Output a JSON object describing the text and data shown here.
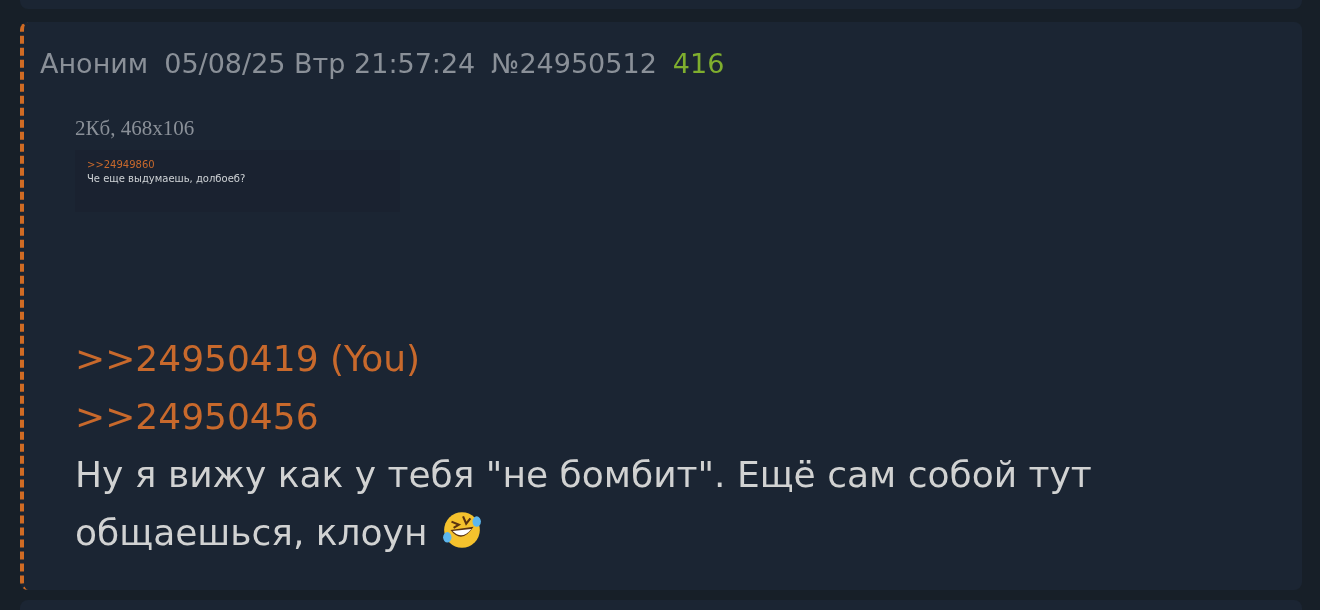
{
  "post": {
    "author": "Аноним",
    "datetime": "05/08/25 Втр 21:57:24",
    "number": "№24950512",
    "reply_count": "416",
    "file": {
      "info": "2Кб, 468x106",
      "screenshot": {
        "quote_link": ">>24949860",
        "text": "Че еще выдумаешь, долбоеб?"
      }
    },
    "replies": [
      {
        "link": ">>24950419",
        "marker": "(You)"
      },
      {
        "link": ">>24950456"
      }
    ],
    "message_lines": [
      "Ну я вижу как у тебя \"не бомбит\". Ещё сам собой тут",
      "общаешься, клоун"
    ]
  }
}
